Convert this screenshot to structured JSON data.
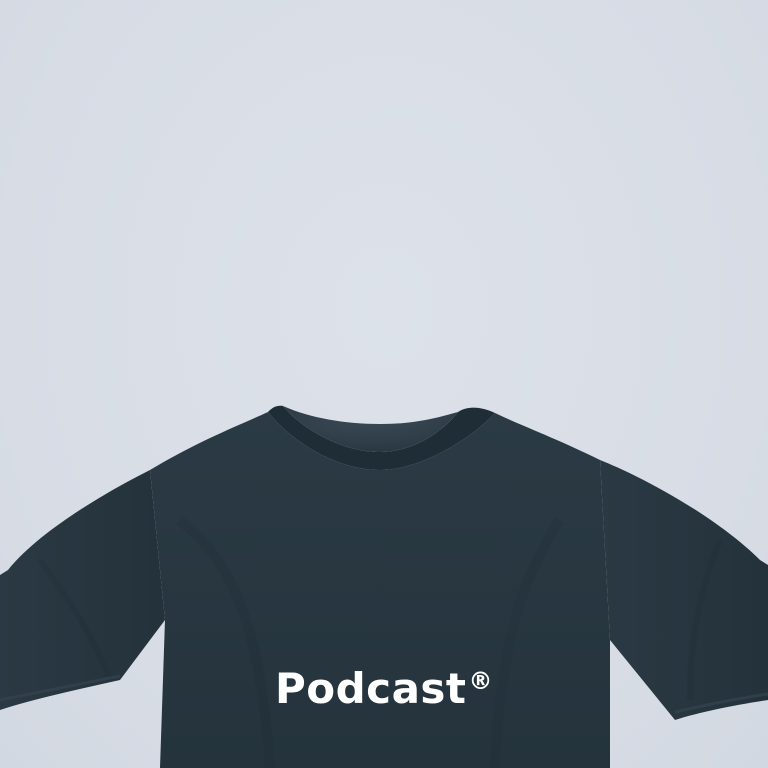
{
  "product": {
    "print_text": "Podcast",
    "print_mark": "®",
    "shirt_color": "#27363f",
    "background_color": "#d9dee6"
  }
}
